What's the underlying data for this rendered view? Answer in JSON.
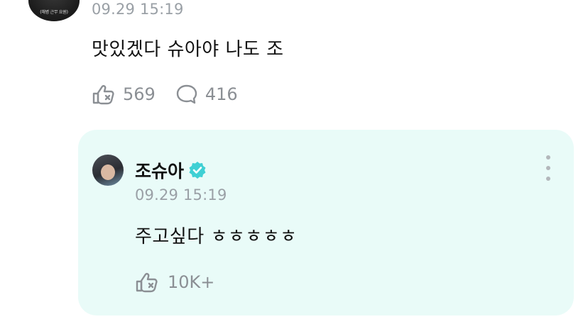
{
  "post": {
    "avatar_tag": "(해병 근무 요원)",
    "time": "09.29 15:19",
    "text": "맛있겠다 슈아야 나도 조",
    "likes": "569",
    "comments": "416"
  },
  "reply": {
    "author": "조슈아",
    "verified": true,
    "time": "09.29 15:19",
    "text": "주고싶다 ㅎㅎㅎㅎㅎ",
    "likes": "10K+"
  },
  "icons": {
    "like": "like-hand-icon",
    "comment": "comment-bubble-icon",
    "verified": "verified-badge-icon",
    "more": "more-vertical-icon"
  },
  "colors": {
    "reply_background": "#e9fbf8",
    "verified": "#3fd0d4",
    "muted": "#9aa0a6"
  }
}
